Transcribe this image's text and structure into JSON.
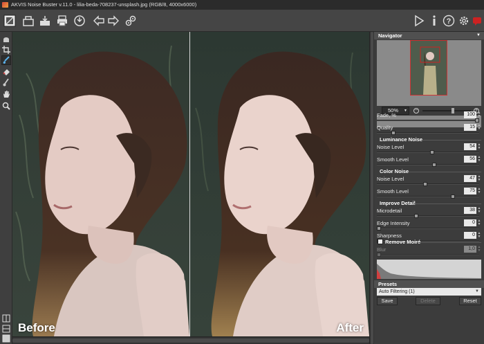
{
  "window": {
    "title": "AKVIS Noise Buster v.11.0 - lilia-beda-708237-unsplash.jpg (RGB/8, 4000x6000)"
  },
  "toolbar": {
    "left": [
      {
        "name": "canvas-view-icon"
      },
      {
        "name": "open-file-icon"
      },
      {
        "name": "save-file-icon"
      },
      {
        "name": "print-icon"
      },
      {
        "name": "share-icon"
      },
      {
        "name": "undo-arrow-icon"
      },
      {
        "name": "redo-arrow-icon"
      },
      {
        "name": "batch-settings-icon"
      }
    ],
    "right": [
      {
        "name": "run-play-icon"
      },
      {
        "name": "info-icon"
      },
      {
        "name": "help-icon"
      },
      {
        "name": "settings-gear-icon"
      },
      {
        "name": "notifications-icon"
      }
    ]
  },
  "left_tools": [
    {
      "name": "hand-view-icon"
    },
    {
      "name": "crop-tool-icon"
    },
    {
      "name": "brush-tool-icon"
    },
    {
      "name": "eraser-tool-icon"
    },
    {
      "name": "history-brush-icon"
    },
    {
      "name": "hand-tool-icon"
    },
    {
      "name": "zoom-tool-icon"
    }
  ],
  "canvas": {
    "before_label": "Before",
    "after_label": "After"
  },
  "navigator": {
    "title": "Navigator",
    "zoom": "50%"
  },
  "settings": {
    "fade": {
      "label": "Fade, %",
      "value": "100",
      "level": 1.0
    },
    "quality": {
      "label": "Quality",
      "value": "15",
      "level": 0.15
    },
    "luminance_title": "Luminance Noise",
    "lum_noise": {
      "label": "Noise Level",
      "value": "54",
      "level": 0.54
    },
    "lum_smooth": {
      "label": "Smooth Level",
      "value": "56",
      "level": 0.56
    },
    "color_title": "Color Noise",
    "col_noise": {
      "label": "Noise Level",
      "value": "47",
      "level": 0.47
    },
    "col_smooth": {
      "label": "Smooth Level",
      "value": "75",
      "level": 0.75
    },
    "detail_title": "Improve Detail",
    "microdetail": {
      "label": "Microdetail",
      "value": "38",
      "level": 0.38
    },
    "edge": {
      "label": "Edge Intensity",
      "value": "0",
      "level": 0.0
    },
    "sharpness": {
      "label": "Sharpness",
      "value": "0",
      "level": 0.0
    },
    "moire_title": "Remove Moiré",
    "blur": {
      "label": "Blur",
      "value": "1,0",
      "level": 0.0
    }
  },
  "presets": {
    "title": "Presets",
    "selected": "Auto Filtering (1)",
    "save_label": "Save",
    "delete_label": "Delete",
    "reset_label": "Reset"
  },
  "colors": {
    "accent_red": "#cc2222",
    "panel_bg": "#3c3c3c",
    "header_bg": "#505050"
  }
}
